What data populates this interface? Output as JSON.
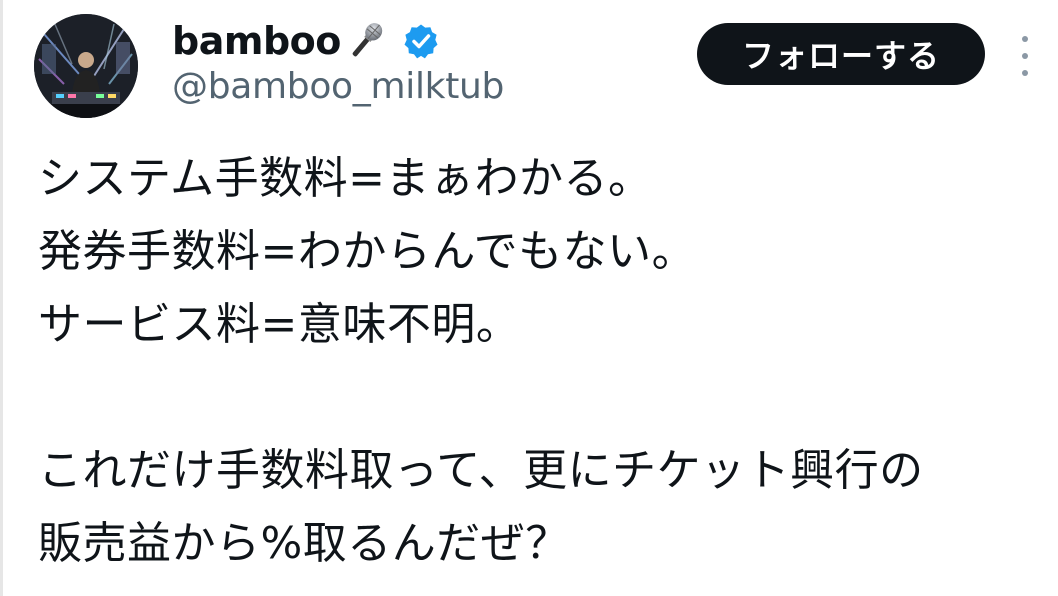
{
  "author": {
    "display_name": "bamboo",
    "name_emoji": "microphone-emoji",
    "verified": true,
    "handle": "@bamboo_milktub",
    "avatar": "profile-photo"
  },
  "actions": {
    "follow_label": "フォローする",
    "more_icon": "vertical-ellipsis-icon"
  },
  "tweet": {
    "lines": [
      "システム手数料=まぁわかる。",
      "発券手数料=わからんでもない。",
      "サービス料=意味不明。",
      "",
      "これだけ手数料取って、更にチケット興行の",
      "販売益から%取るんだぜ？"
    ]
  },
  "colors": {
    "text_primary": "#0f1419",
    "text_secondary": "#536471",
    "follow_bg": "#0f1419",
    "follow_text": "#ffffff",
    "verified_blue": "#1d9bf0"
  }
}
